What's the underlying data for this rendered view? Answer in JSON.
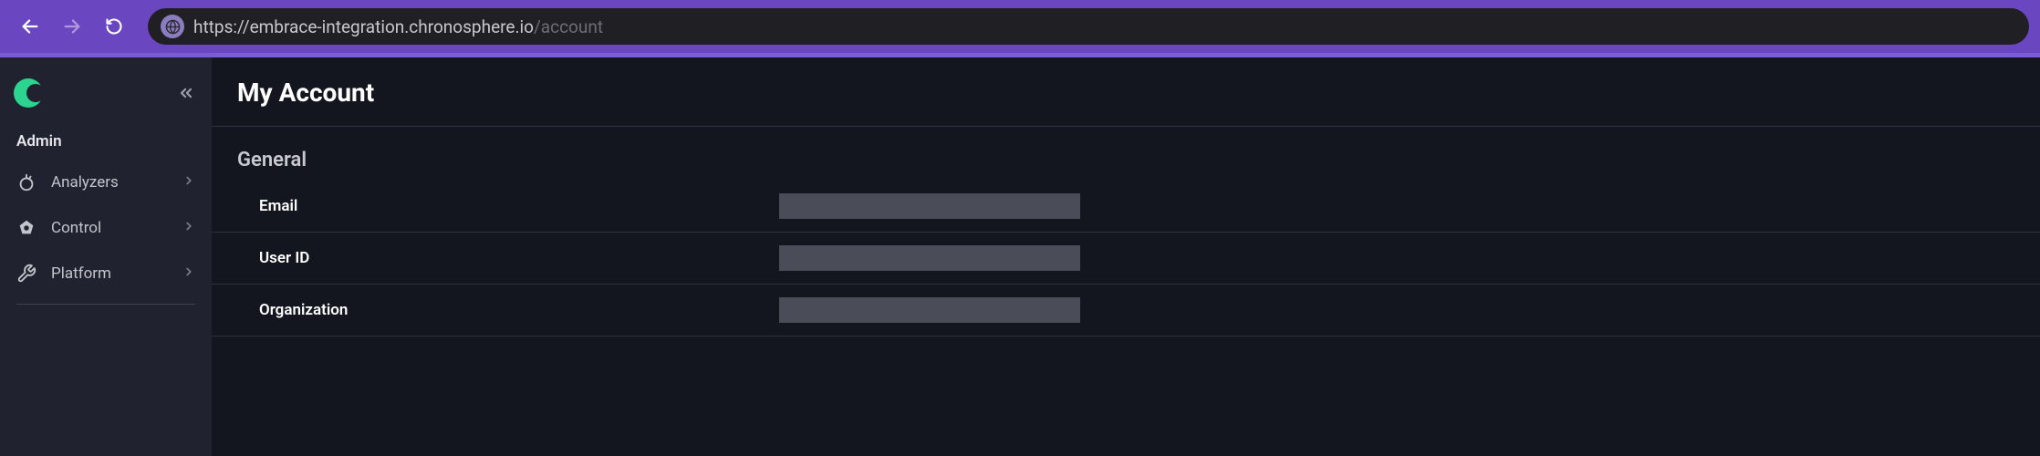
{
  "browser": {
    "url_base": "https://embrace-integration.chronosphere.io",
    "url_path": "/account"
  },
  "sidebar": {
    "section": "Admin",
    "items": [
      {
        "label": "Analyzers",
        "icon": "analyzers-icon"
      },
      {
        "label": "Control",
        "icon": "control-icon"
      },
      {
        "label": "Platform",
        "icon": "platform-icon"
      }
    ]
  },
  "page": {
    "title": "My Account",
    "section": "General",
    "fields": [
      {
        "label": "Email"
      },
      {
        "label": "User ID"
      },
      {
        "label": "Organization"
      }
    ]
  }
}
